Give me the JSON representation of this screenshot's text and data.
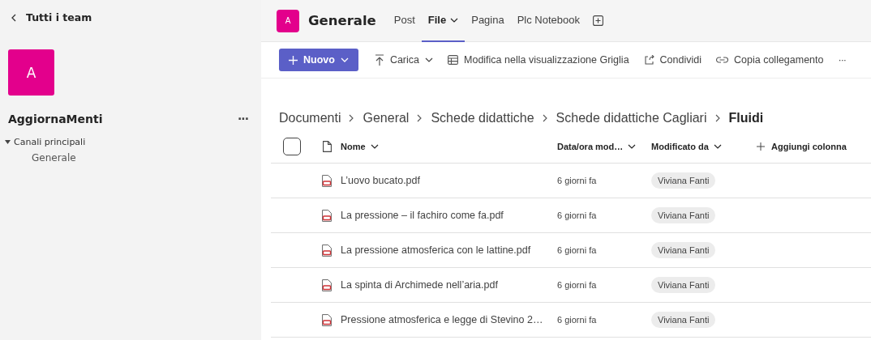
{
  "sidebar": {
    "back_label": "Tutti i team",
    "team_avatar": "A",
    "team_name": "AggiornaMenti",
    "more": "···",
    "sections": [
      {
        "label": "Canali principali",
        "expanded": true,
        "children": [
          {
            "label": "Generale"
          }
        ]
      }
    ]
  },
  "header": {
    "avatar": "A",
    "channel": "Generale",
    "tabs": [
      {
        "label": "Post",
        "selected": false,
        "dropdown": false
      },
      {
        "label": "File",
        "selected": true,
        "dropdown": true
      },
      {
        "label": "Pagina",
        "selected": false,
        "dropdown": false
      },
      {
        "label": "Plc Notebook",
        "selected": false,
        "dropdown": false
      }
    ]
  },
  "toolbar": [
    {
      "kind": "new",
      "label": "Nuovo"
    },
    {
      "kind": "upload",
      "label": "Carica"
    },
    {
      "kind": "grid",
      "label": "Modifica nella visualizzazione Griglia"
    },
    {
      "kind": "share",
      "label": "Condividi"
    },
    {
      "kind": "link",
      "label": "Copia collegamento"
    },
    {
      "kind": "more",
      "label": "···"
    }
  ],
  "breadcrumb": [
    "Documenti",
    "General",
    "Schede didattiche",
    "Schede didattiche Cagliari",
    "Fluidi"
  ],
  "table": {
    "select_all": {
      "checked": false
    },
    "columns": [
      "Nome",
      "Data/ora mod…",
      "Modificato da"
    ],
    "add_column": "Aggiungi colonna",
    "rows": [
      {
        "name": "L’uovo bucato.pdf",
        "modified": "6 giorni fa",
        "modified_by": "Viviana Fanti"
      },
      {
        "name": "La pressione – il fachiro come fa.pdf",
        "modified": "6 giorni fa",
        "modified_by": "Viviana Fanti"
      },
      {
        "name": "La pressione atmosferica con le lattine.pdf",
        "modified": "6 giorni fa",
        "modified_by": "Viviana Fanti"
      },
      {
        "name": "La spinta di Archimede nell’aria.pdf",
        "modified": "6 giorni fa",
        "modified_by": "Viviana Fanti"
      },
      {
        "name": "Pressione atmosferica e legge di Stevino 2…",
        "modified": "6 giorni fa",
        "modified_by": "Viviana Fanti"
      }
    ]
  }
}
